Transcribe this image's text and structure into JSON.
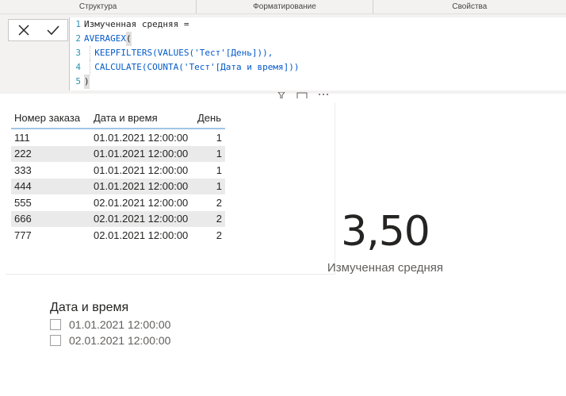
{
  "ribbon": {
    "groups": [
      "Структура",
      "Форматирование",
      "Свойства"
    ]
  },
  "formula_bar": {
    "cancel_icon": "close-icon",
    "commit_icon": "checkmark-icon",
    "lines": [
      {
        "no": "1",
        "text": "Измученная средняя ="
      },
      {
        "no": "2",
        "fn": "AVERAGEX",
        "text": "("
      },
      {
        "no": "3",
        "text": "  KEEPFILTERS(VALUES('Тест'[День])),"
      },
      {
        "no": "4",
        "text": "  CALCULATE(COUNTA('Тест'[Дата и время]))"
      },
      {
        "no": "5",
        "text": ")"
      }
    ]
  },
  "table": {
    "headers": [
      "Номер заказа",
      "Дата и время",
      "День"
    ],
    "rows": [
      [
        "111",
        "01.01.2021 12:00:00",
        "1"
      ],
      [
        "222",
        "01.01.2021 12:00:00",
        "1"
      ],
      [
        "333",
        "01.01.2021 12:00:00",
        "1"
      ],
      [
        "444",
        "01.01.2021 12:00:00",
        "1"
      ],
      [
        "555",
        "02.01.2021 12:00:00",
        "2"
      ],
      [
        "666",
        "02.01.2021 12:00:00",
        "2"
      ],
      [
        "777",
        "02.01.2021 12:00:00",
        "2"
      ]
    ]
  },
  "card": {
    "value": "3,50",
    "label": "Измученная средняя"
  },
  "slicer": {
    "title": "Дата и время",
    "items": [
      "01.01.2021 12:00:00",
      "02.01.2021 12:00:00"
    ]
  },
  "colors": {
    "header_underline": "#a3c5e6",
    "row_alt": "#eaeaea",
    "row_selected": "#b3b3b3",
    "code_function": "#035aca",
    "line_number": "#2b91af"
  }
}
